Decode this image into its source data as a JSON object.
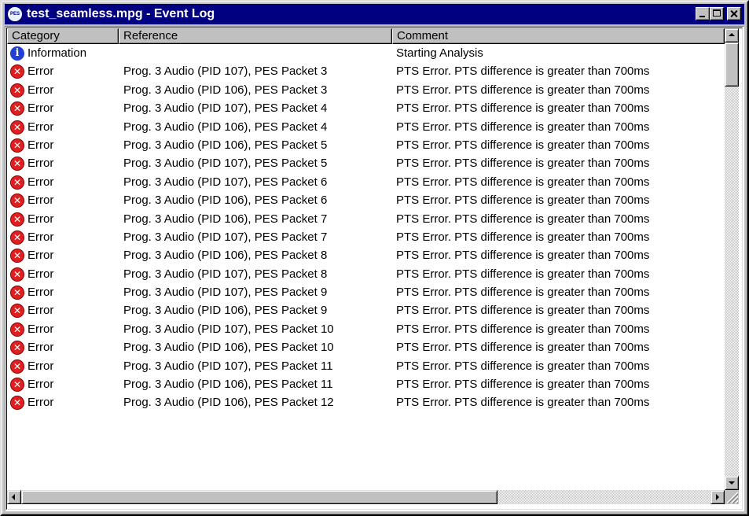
{
  "window": {
    "title": "test_seamless.mpg - Event Log",
    "app_icon_label": "PES"
  },
  "columns": [
    "Category",
    "Reference",
    "Comment"
  ],
  "rows": [
    {
      "icon": "info-icon",
      "category": "Information",
      "reference": "",
      "comment": "Starting Analysis"
    },
    {
      "icon": "error-icon",
      "category": "Error",
      "reference": "Prog. 3 Audio (PID 107), PES Packet 3",
      "comment": "PTS Error. PTS difference is greater than 700ms"
    },
    {
      "icon": "error-icon",
      "category": "Error",
      "reference": "Prog. 3 Audio (PID 106), PES Packet 3",
      "comment": "PTS Error. PTS difference is greater than 700ms"
    },
    {
      "icon": "error-icon",
      "category": "Error",
      "reference": "Prog. 3 Audio (PID 107), PES Packet 4",
      "comment": "PTS Error. PTS difference is greater than 700ms"
    },
    {
      "icon": "error-icon",
      "category": "Error",
      "reference": "Prog. 3 Audio (PID 106), PES Packet 4",
      "comment": "PTS Error. PTS difference is greater than 700ms"
    },
    {
      "icon": "error-icon",
      "category": "Error",
      "reference": "Prog. 3 Audio (PID 106), PES Packet 5",
      "comment": "PTS Error. PTS difference is greater than 700ms"
    },
    {
      "icon": "error-icon",
      "category": "Error",
      "reference": "Prog. 3 Audio (PID 107), PES Packet 5",
      "comment": "PTS Error. PTS difference is greater than 700ms"
    },
    {
      "icon": "error-icon",
      "category": "Error",
      "reference": "Prog. 3 Audio (PID 107), PES Packet 6",
      "comment": "PTS Error. PTS difference is greater than 700ms"
    },
    {
      "icon": "error-icon",
      "category": "Error",
      "reference": "Prog. 3 Audio (PID 106), PES Packet 6",
      "comment": "PTS Error. PTS difference is greater than 700ms"
    },
    {
      "icon": "error-icon",
      "category": "Error",
      "reference": "Prog. 3 Audio (PID 106), PES Packet 7",
      "comment": "PTS Error. PTS difference is greater than 700ms"
    },
    {
      "icon": "error-icon",
      "category": "Error",
      "reference": "Prog. 3 Audio (PID 107), PES Packet 7",
      "comment": "PTS Error. PTS difference is greater than 700ms"
    },
    {
      "icon": "error-icon",
      "category": "Error",
      "reference": "Prog. 3 Audio (PID 106), PES Packet 8",
      "comment": "PTS Error. PTS difference is greater than 700ms"
    },
    {
      "icon": "error-icon",
      "category": "Error",
      "reference": "Prog. 3 Audio (PID 107), PES Packet 8",
      "comment": "PTS Error. PTS difference is greater than 700ms"
    },
    {
      "icon": "error-icon",
      "category": "Error",
      "reference": "Prog. 3 Audio (PID 107), PES Packet 9",
      "comment": "PTS Error. PTS difference is greater than 700ms"
    },
    {
      "icon": "error-icon",
      "category": "Error",
      "reference": "Prog. 3 Audio (PID 106), PES Packet 9",
      "comment": "PTS Error. PTS difference is greater than 700ms"
    },
    {
      "icon": "error-icon",
      "category": "Error",
      "reference": "Prog. 3 Audio (PID 107), PES Packet 10",
      "comment": "PTS Error. PTS difference is greater than 700ms"
    },
    {
      "icon": "error-icon",
      "category": "Error",
      "reference": "Prog. 3 Audio (PID 106), PES Packet 10",
      "comment": "PTS Error. PTS difference is greater than 700ms"
    },
    {
      "icon": "error-icon",
      "category": "Error",
      "reference": "Prog. 3 Audio (PID 107), PES Packet 11",
      "comment": "PTS Error. PTS difference is greater than 700ms"
    },
    {
      "icon": "error-icon",
      "category": "Error",
      "reference": "Prog. 3 Audio (PID 106), PES Packet 11",
      "comment": "PTS Error. PTS difference is greater than 700ms"
    },
    {
      "icon": "error-icon",
      "category": "Error",
      "reference": "Prog. 3 Audio (PID 106), PES Packet 12",
      "comment": "PTS Error. PTS difference is greater than 700ms"
    }
  ],
  "colors": {
    "titlebar": "#000080",
    "info_icon": "#1f3fd6",
    "error_icon": "#e02020",
    "face": "#c0c0c0"
  }
}
